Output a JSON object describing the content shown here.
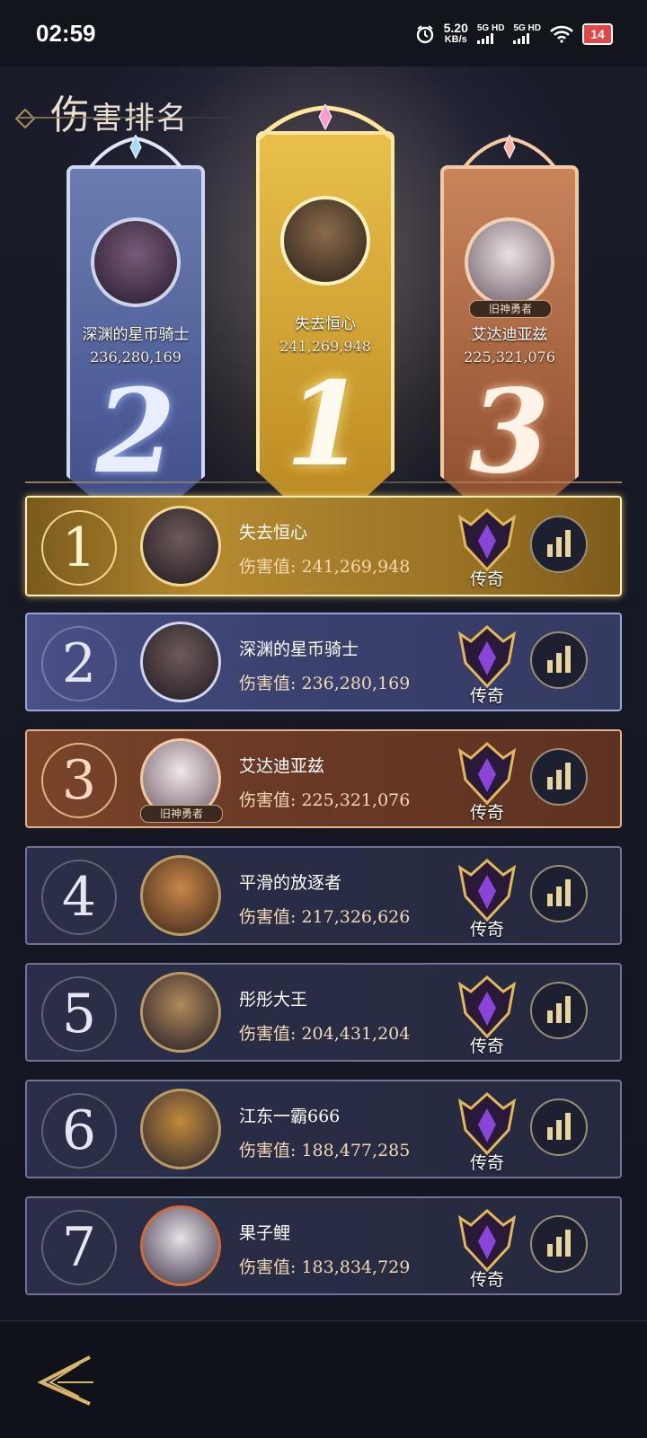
{
  "status_bar": {
    "time": "02:59",
    "speed_value": "5.20",
    "speed_unit": "KB/s",
    "net1": "5G HD",
    "net2": "5G HD",
    "battery": "14",
    "icons": [
      "alarm-icon",
      "signal-icon",
      "wifi-icon",
      "battery-icon"
    ]
  },
  "page": {
    "title_first": "伤",
    "title_rest": "害排名"
  },
  "podium": {
    "first": {
      "rank": "1",
      "name": "失去恒心",
      "value": "241,269,948"
    },
    "second": {
      "rank": "2",
      "name": "深渊的星币骑士",
      "value": "236,280,169"
    },
    "third": {
      "rank": "3",
      "name": "艾达迪亚兹",
      "value": "225,321,076",
      "tag": "旧神勇者"
    }
  },
  "damage_label": "伤害值:",
  "tier_label": "传奇",
  "rows": [
    {
      "rank": "1",
      "name": "失去恒心",
      "value": "241,269,948"
    },
    {
      "rank": "2",
      "name": "深渊的星币骑士",
      "value": "236,280,169"
    },
    {
      "rank": "3",
      "name": "艾达迪亚兹",
      "value": "225,321,076",
      "tag": "旧神勇者"
    },
    {
      "rank": "4",
      "name": "平滑的放逐者",
      "value": "217,326,626"
    },
    {
      "rank": "5",
      "name": "彤彤大王",
      "value": "204,431,204"
    },
    {
      "rank": "6",
      "name": "江东一霸666",
      "value": "188,477,285"
    },
    {
      "rank": "7",
      "name": "果子鲤",
      "value": "183,834,729"
    }
  ],
  "colors": {
    "gold": "#e9bf4a",
    "silver": "#6a7cb2",
    "bronze": "#c9845a",
    "tier_purple": "#7a3cc8"
  }
}
